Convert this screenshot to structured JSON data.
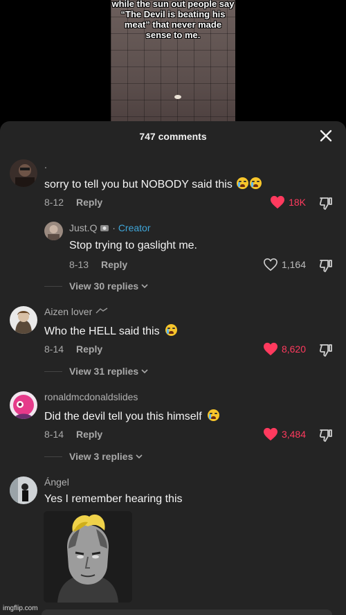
{
  "video": {
    "caption": "while the sun out people say “The Devil is beating his meat” that never made sense to me."
  },
  "sheet": {
    "title": "747 comments"
  },
  "comments": [
    {
      "username": ".",
      "text": "sorry to tell you but NOBODY said this",
      "date": "8-12",
      "reply_label": "Reply",
      "likes": "18K",
      "liked": true
    },
    {
      "username": "Just.Q",
      "badge": "Creator",
      "text": "Stop trying to gaslight me.",
      "date": "8-13",
      "reply_label": "Reply",
      "likes": "1,164",
      "liked": false
    },
    {
      "username": "Aizen lover",
      "text": "Who the HELL said this",
      "date": "8-14",
      "reply_label": "Reply",
      "likes": "8,620",
      "liked": true
    },
    {
      "username": "ronaldmcdonaldslides",
      "text": "Did the devil tell you this himself",
      "date": "8-14",
      "reply_label": "Reply",
      "likes": "3,484",
      "liked": true
    },
    {
      "username": "Ángel",
      "text": "Yes I remember hearing this"
    }
  ],
  "view_replies": [
    "View 30 replies",
    "View 31 replies",
    "View 3 replies"
  ],
  "watermark": "imgflip.com",
  "colors": {
    "sheet_bg": "#242424",
    "like_red": "#ff3a5e",
    "creator_blue": "#3fa6d9"
  }
}
